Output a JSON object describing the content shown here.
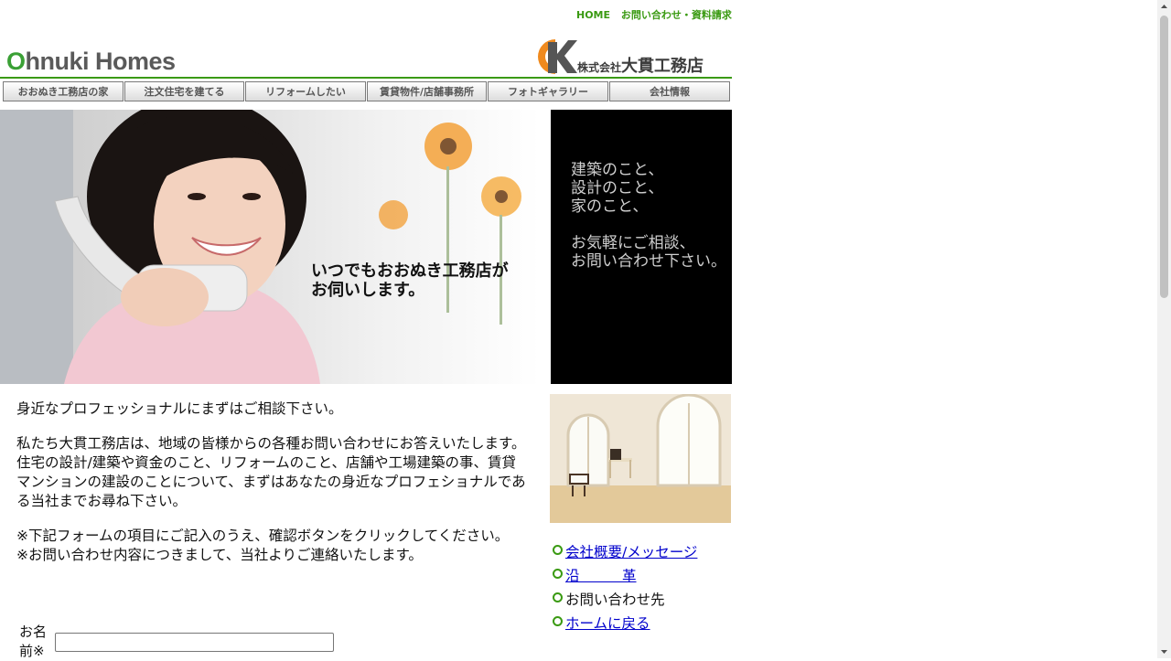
{
  "header": {
    "top_links": [
      "HOME",
      "お問い合わせ・資料請求"
    ],
    "logo_first_letter": "O",
    "logo_rest": "hnuki Homes",
    "corp_prefix": "株式会社",
    "corp_name": "大貫工務店",
    "colors": {
      "accent_green": "#3a9a12",
      "logo_orange": "#f08a1e"
    }
  },
  "nav": {
    "items": [
      "おおぬき工務店の家",
      "注文住宅を建てる",
      "リフォームしたい",
      "賃貸物件/店舗事務所",
      "フォトギャラリー",
      "会社情報"
    ]
  },
  "hero": {
    "caption_line1": "いつでもおおぬき工務店が",
    "caption_line2": "お伺いします。"
  },
  "sidebar": {
    "black_lines_top": [
      "建築のこと、",
      "設計のこと、",
      "家のこと、"
    ],
    "black_lines_bottom": [
      "お気軽にご相談、",
      "お問い合わせ下さい。"
    ],
    "links": [
      {
        "label": "会社概要/メッセージ",
        "link": true
      },
      {
        "label": "沿　　　革",
        "link": true
      },
      {
        "label": "お問い合わせ先",
        "link": false
      },
      {
        "label": "ホームに戻る",
        "link": true
      }
    ]
  },
  "main": {
    "paragraph1": "身近なプロフェッショナルにまずはご相談下さい。",
    "paragraph2": "私たち大貫工務店は、地域の皆様からの各種お問い合わせにお答えいたします。住宅の設計/建築や資金のこと、リフォームのこと、店舗や工場建築の事、賃貸マンションの建設のことについて、まずはあなたの身近なプロフェショナルである当社までお尋ね下さい。",
    "note1": "※下記フォームの項目にご記入のうえ、確認ボタンをクリックしてください。",
    "note2": "※お問い合わせ内容につきまして、当社よりご連絡いたします。"
  },
  "form": {
    "name_label_line1": "お名",
    "name_label_line2": "前※",
    "name_value": ""
  }
}
